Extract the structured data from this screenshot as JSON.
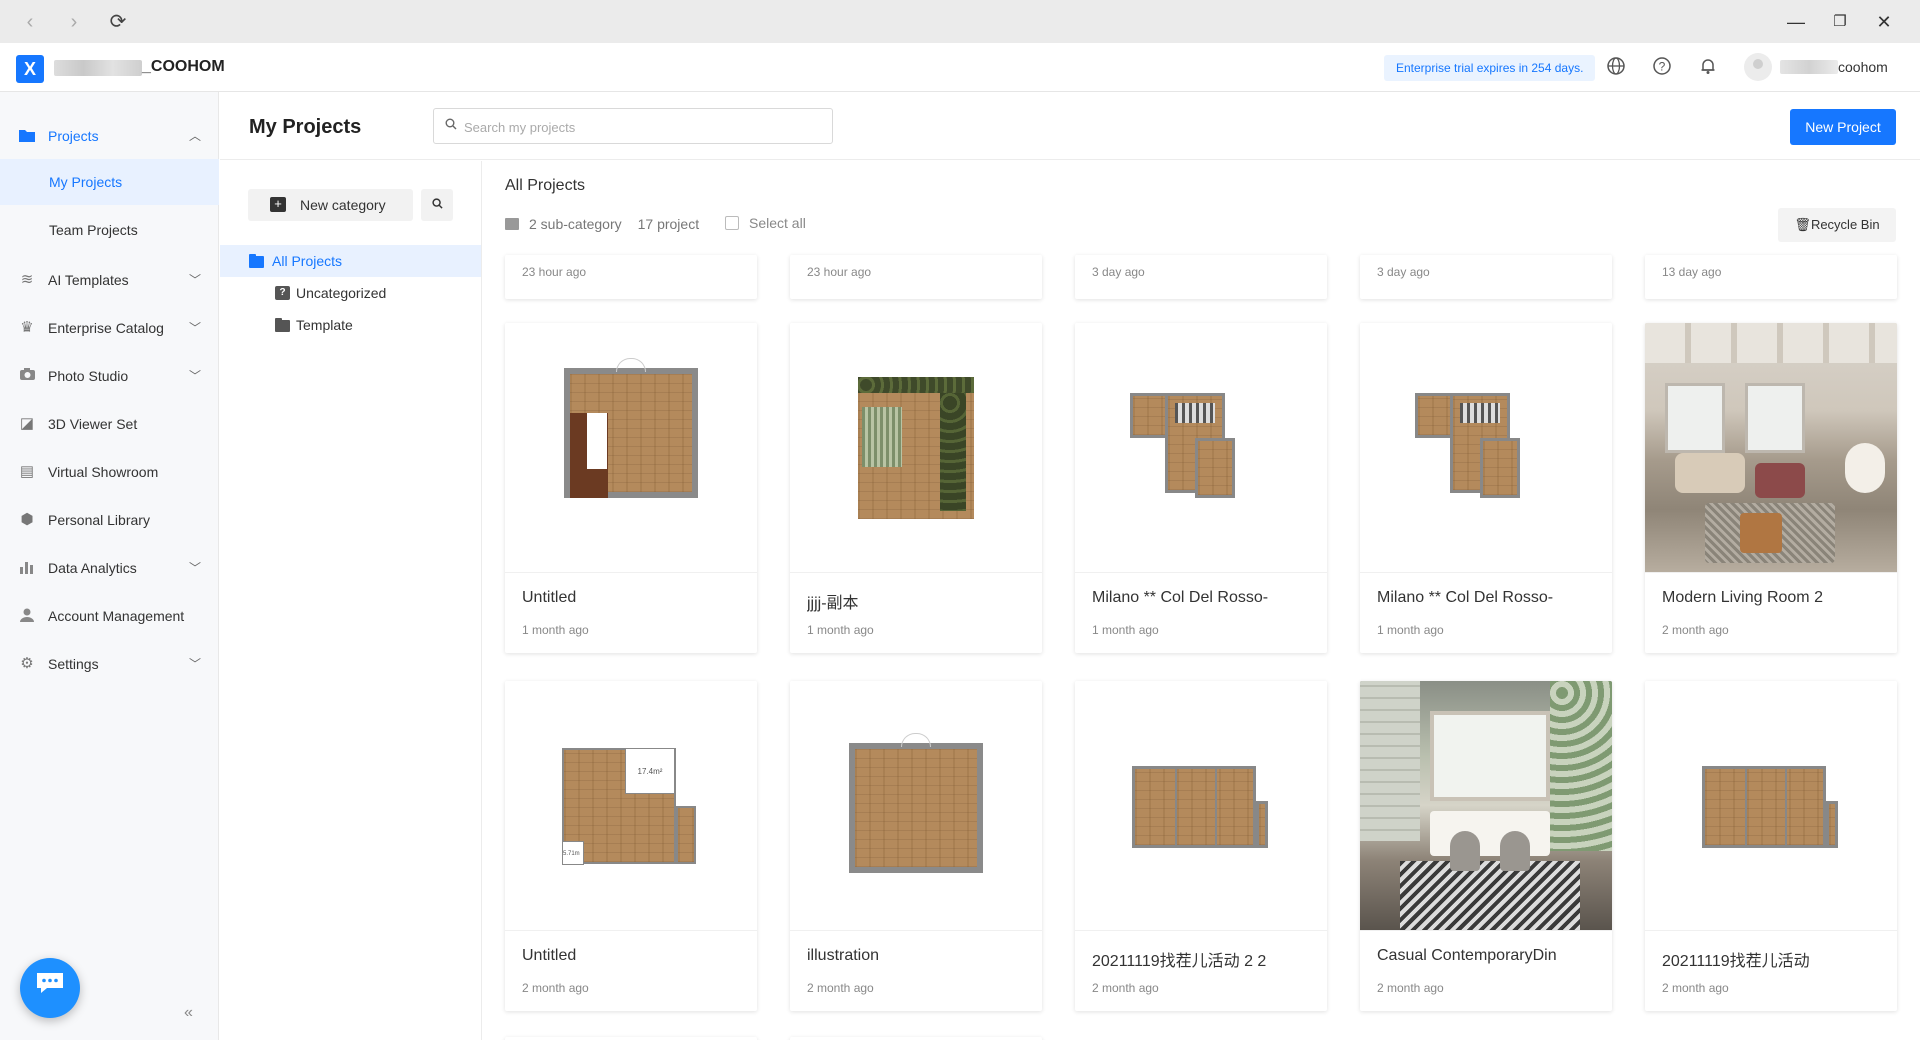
{
  "app": {
    "org_name": "_COOHOM",
    "logo_letter": "X",
    "trial_notice": "Enterprise trial expires in 254 days.",
    "user_name": "coohom"
  },
  "sidebar": {
    "items": [
      {
        "label": "Projects",
        "icon": "folder-icon",
        "expanded": true
      },
      {
        "label": "My Projects",
        "sub": true,
        "selected": true
      },
      {
        "label": "Team Projects",
        "sub": true
      },
      {
        "label": "AI Templates",
        "icon": "ai-icon",
        "chevron": true
      },
      {
        "label": "Enterprise Catalog",
        "icon": "crown-icon",
        "chevron": true
      },
      {
        "label": "Photo Studio",
        "icon": "camera-icon",
        "chevron": true
      },
      {
        "label": "3D Viewer Set",
        "icon": "viewer-icon"
      },
      {
        "label": "Virtual Showroom",
        "icon": "showroom-icon"
      },
      {
        "label": "Personal Library",
        "icon": "cube-icon"
      },
      {
        "label": "Data Analytics",
        "icon": "bar-chart-icon",
        "chevron": true
      },
      {
        "label": "Account Management",
        "icon": "user-icon"
      },
      {
        "label": "Settings",
        "icon": "gear-icon",
        "chevron": true
      }
    ]
  },
  "header": {
    "title": "My Projects",
    "search_placeholder": "Search my projects",
    "new_project": "New Project"
  },
  "categories": {
    "new_category": "New category",
    "tree": [
      {
        "label": "All Projects",
        "selected": true
      },
      {
        "label": "Uncategorized"
      },
      {
        "label": "Template"
      }
    ]
  },
  "content": {
    "title": "All Projects",
    "sub_category": "2 sub-category",
    "project_count": "17 project",
    "select_all": "Select all",
    "recycle_bin": "Recycle Bin"
  },
  "top_row_dates": [
    "23 hour ago",
    "23 hour ago",
    "3 day ago",
    "3 day ago",
    "13 day ago"
  ],
  "projects": [
    {
      "name": "Untitled",
      "date": "1 month ago"
    },
    {
      "name": "jjjj-副本",
      "date": "1 month ago"
    },
    {
      "name": "Milano ** Col Del Rosso-",
      "date": "1 month ago"
    },
    {
      "name": "Milano ** Col Del Rosso-",
      "date": "1 month ago"
    },
    {
      "name": "Modern Living Room 2",
      "date": "2 month ago"
    },
    {
      "name": "Untitled",
      "date": "2 month ago"
    },
    {
      "name": "illustration",
      "date": "2 month ago"
    },
    {
      "name": "20211119找茬儿活动 2 2",
      "date": "2 month ago"
    },
    {
      "name": "Casual ContemporaryDin",
      "date": "2 month ago"
    },
    {
      "name": "20211119找茬儿活动",
      "date": "2 month ago"
    }
  ],
  "floorplan_labels": {
    "area_1": "17.4m²",
    "area_2": "5.71m"
  },
  "colors": {
    "accent": "#1677ff",
    "selected_bg": "#e8f1ff",
    "sidebar_bg": "#f7f8fa"
  }
}
